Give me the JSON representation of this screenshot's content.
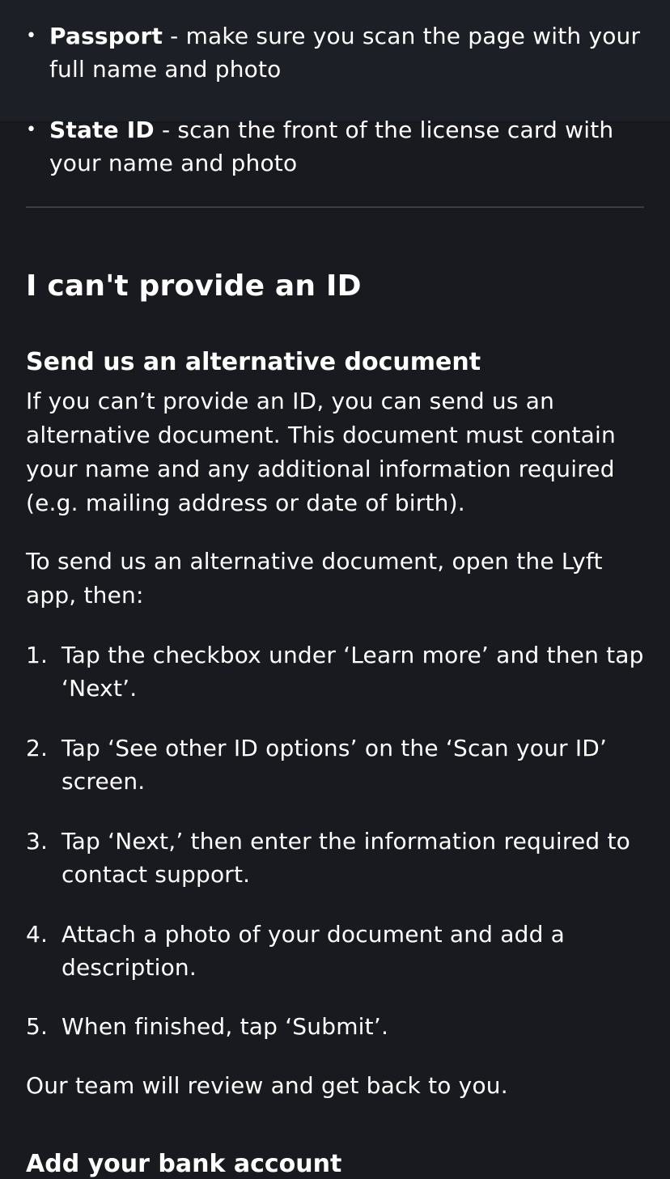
{
  "id_options": [
    {
      "title": "Passport",
      "text": " - make sure you scan the page with your full name and photo"
    },
    {
      "title": "State ID",
      "text": " - scan the front of the license card with your name and photo"
    }
  ],
  "section": {
    "heading": "I can't provide an ID",
    "subheading": "Send us an alternative document",
    "paragraph_1": "If you can’t provide an ID, you can send us an alternative document. This document must contain your name and any additional information required (e.g. mailing address or date of birth).",
    "paragraph_2": "To send us an alternative document, open the Lyft app, then:",
    "steps": [
      {
        "number": "1.",
        "text": "Tap the checkbox under ‘Learn more’ and then tap ‘Next’."
      },
      {
        "number": "2.",
        "text": "Tap ‘See other ID options’ on the ‘Scan your ID’ screen."
      },
      {
        "number": "3.",
        "text": "Tap ‘Next,’ then enter the information required to contact support."
      },
      {
        "number": "4.",
        "text": "Attach a photo of your document and add a description."
      },
      {
        "number": "5.",
        "text": "When finished, tap ‘Submit’."
      }
    ],
    "closing": "Our team will review and get back to you."
  },
  "next_section": {
    "heading": "Add your bank account"
  }
}
